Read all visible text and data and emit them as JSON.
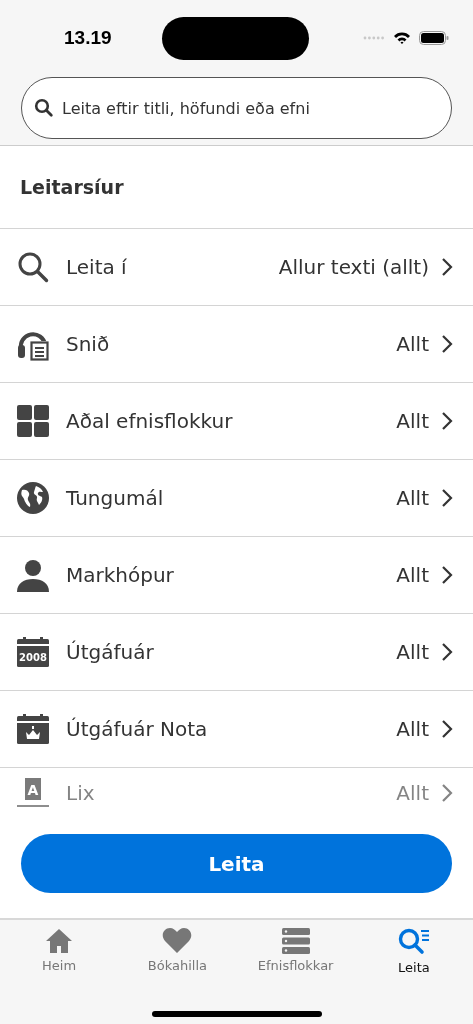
{
  "status_bar": {
    "time": "13.19"
  },
  "search": {
    "placeholder": "Leita eftir titli, höfundi eða efni"
  },
  "filters": {
    "title": "Leitarsíur",
    "rows": [
      {
        "kind": "search",
        "label": "Leita í",
        "value": "Allur texti (allt)",
        "faded": false
      },
      {
        "kind": "format",
        "label": "Snið",
        "value": "Allt",
        "faded": false
      },
      {
        "kind": "grid",
        "label": "Aðal efnisflokkur",
        "value": "Allt",
        "faded": false
      },
      {
        "kind": "globe",
        "label": "Tungumál",
        "value": "Allt",
        "faded": false
      },
      {
        "kind": "person",
        "label": "Markhópur",
        "value": "Allt",
        "faded": false
      },
      {
        "kind": "year",
        "icon_text": "2008",
        "label": "Útgáfuár",
        "value": "Allt",
        "faded": false
      },
      {
        "kind": "crown",
        "label": "Útgáfuár Nota",
        "value": "Allt",
        "faded": false
      },
      {
        "kind": "lix",
        "icon_text": "A",
        "label": "Lix",
        "value": "Allt",
        "faded": true
      }
    ]
  },
  "search_button": "Leita",
  "tabs": [
    {
      "kind": "home",
      "label": "Heim",
      "selected": false
    },
    {
      "kind": "heart",
      "label": "Bókahilla",
      "selected": false
    },
    {
      "kind": "list",
      "label": "Efnisflokkar",
      "selected": false
    },
    {
      "kind": "search",
      "label": "Leita",
      "selected": true
    }
  ]
}
